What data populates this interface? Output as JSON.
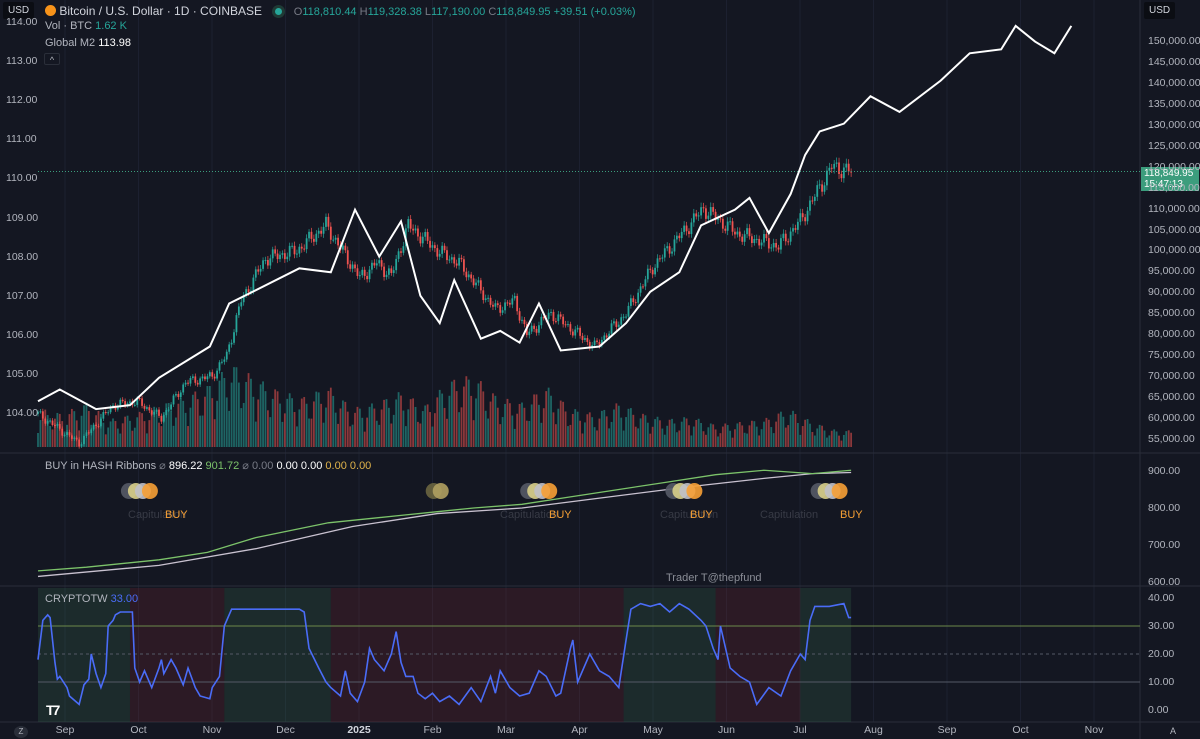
{
  "header": {
    "currency_left": "USD",
    "currency_right": "USD",
    "symbol": "Bitcoin / U.S. Dollar · 1D · COINBASE",
    "o_label": "O",
    "o": "118,810.44",
    "h_label": "H",
    "h": "119,328.38",
    "l_label": "L",
    "l": "117,190.00",
    "c_label": "C",
    "c": "118,849.95",
    "change": "+39.51 (+0.03%)",
    "vol_label": "Vol · BTC",
    "vol": "1.62 K",
    "m2_label": "Global M2",
    "m2": "113.98",
    "collapse": "^"
  },
  "price_badge": {
    "price": "118,849.95",
    "countdown": "15:47:13"
  },
  "colors": {
    "up": "#26a69a",
    "down": "#ef5350",
    "m2": "#ffffff",
    "hash_fast": "#7cc36a",
    "hash_slow": "#c9c2d0",
    "osc": "#4a6cf7",
    "buy": "#f7a035"
  },
  "hash": {
    "title": "BUY in HASH Ribbons",
    "v1": "896.22",
    "v2": "901.72",
    "v3": "0.00",
    "v4": "0.00",
    "v5": "0.00",
    "v6": "0.00",
    "v7": "0.00",
    "buy_labels": [
      "BUY",
      "BUY",
      "BUY",
      "BUY"
    ],
    "cap_labels": [
      "Capitulation",
      "Capitulation",
      "Capitulation",
      "Capitulation"
    ],
    "watermark": "Trader T@thepfund"
  },
  "osc": {
    "title": "CRYPTOTW",
    "value": "33.00"
  },
  "chart_data": [
    {
      "type": "candlestick",
      "title": "Bitcoin / U.S. Dollar · 1D · COINBASE",
      "x_unit": "days since 2024-08-20",
      "ylim": [
        52000,
        157000
      ],
      "yticks": [
        "150,000.00",
        "145,000.00",
        "140,000.00",
        "135,000.00",
        "130,000.00",
        "125,000.00",
        "120,000.00",
        "115,000.00",
        "110,000.00",
        "105,000.00",
        "100,000.00",
        "95,000.00",
        "90,000.00",
        "85,000.00",
        "80,000.00",
        "75,000.00",
        "70,000.00",
        "65,000.00",
        "60,000.00",
        "55,000.00"
      ],
      "close_keypoints": [
        [
          0,
          61000
        ],
        [
          17,
          54000
        ],
        [
          31,
          63000
        ],
        [
          41,
          64000
        ],
        [
          51,
          60000
        ],
        [
          61,
          68500
        ],
        [
          72,
          70000
        ],
        [
          78,
          75000
        ],
        [
          84,
          88000
        ],
        [
          94,
          98000
        ],
        [
          107,
          100000
        ],
        [
          119,
          106000
        ],
        [
          133,
          93500
        ],
        [
          140,
          97000
        ],
        [
          146,
          94000
        ],
        [
          153,
          106000
        ],
        [
          165,
          100000
        ],
        [
          174,
          97000
        ],
        [
          189,
          86000
        ],
        [
          197,
          88000
        ],
        [
          202,
          80000
        ],
        [
          212,
          85000
        ],
        [
          230,
          77000
        ],
        [
          243,
          85000
        ],
        [
          254,
          96000
        ],
        [
          275,
          110000
        ],
        [
          289,
          104000
        ],
        [
          306,
          101000
        ],
        [
          315,
          107000
        ],
        [
          324,
          116000
        ],
        [
          328,
          120000
        ],
        [
          336,
          118850
        ]
      ],
      "volume_k_btc_every_10_days": [
        14,
        12,
        16,
        10,
        12,
        15,
        18,
        22,
        30,
        25,
        20,
        18,
        22,
        14,
        16,
        20,
        15,
        24,
        26,
        18,
        16,
        22,
        14,
        12,
        16,
        12,
        10,
        11,
        8,
        9,
        10,
        14,
        9,
        6
      ]
    },
    {
      "type": "line",
      "name": "Global M2",
      "ylim": [
        103.5,
        114.5
      ],
      "yticks": [
        "114.00",
        "113.00",
        "112.00",
        "111.00",
        "110.00",
        "109.00",
        "108.00",
        "107.00",
        "106.00",
        "105.00",
        "104.00"
      ],
      "points": [
        [
          0,
          104.3
        ],
        [
          9,
          104.6
        ],
        [
          24,
          104.1
        ],
        [
          38,
          104.2
        ],
        [
          50,
          104.9
        ],
        [
          71,
          105.7
        ],
        [
          79,
          106.8
        ],
        [
          108,
          107.7
        ],
        [
          121,
          107.6
        ],
        [
          131,
          109.2
        ],
        [
          141,
          108.0
        ],
        [
          150,
          108.9
        ],
        [
          158,
          107.0
        ],
        [
          166,
          106.3
        ],
        [
          172,
          107.4
        ],
        [
          183,
          105.9
        ],
        [
          191,
          106.1
        ],
        [
          199,
          105.8
        ],
        [
          207,
          106.8
        ],
        [
          216,
          105.6
        ],
        [
          232,
          105.7
        ],
        [
          243,
          106.3
        ],
        [
          253,
          107.1
        ],
        [
          265,
          107.6
        ],
        [
          274,
          108.8
        ],
        [
          288,
          109.2
        ],
        [
          294,
          109.5
        ],
        [
          302,
          108.6
        ],
        [
          311,
          109.6
        ],
        [
          317,
          110.6
        ],
        [
          323,
          111.2
        ],
        [
          333,
          111.4
        ],
        [
          344,
          112.1
        ],
        [
          356,
          111.7
        ],
        [
          373,
          112.5
        ],
        [
          385,
          113.2
        ],
        [
          398,
          113.3
        ],
        [
          404,
          113.9
        ],
        [
          412,
          113.5
        ],
        [
          420,
          113.2
        ],
        [
          427,
          113.9
        ]
      ]
    },
    {
      "type": "line",
      "name": "HASH Ribbons",
      "ylim": [
        580,
        930
      ],
      "yticks": [
        "900.00",
        "800.00",
        "700.00",
        "600.00"
      ],
      "series": [
        {
          "name": "fast",
          "points": [
            [
              0,
              630
            ],
            [
              20,
              640
            ],
            [
              50,
              660
            ],
            [
              70,
              680
            ],
            [
              90,
              720
            ],
            [
              120,
              760
            ],
            [
              150,
              780
            ],
            [
              165,
              790
            ],
            [
              180,
              800
            ],
            [
              200,
              810
            ],
            [
              220,
              830
            ],
            [
              240,
              850
            ],
            [
              260,
              870
            ],
            [
              280,
              890
            ],
            [
              300,
              902
            ],
            [
              320,
              893
            ],
            [
              336,
              902
            ]
          ]
        },
        {
          "name": "slow",
          "points": [
            [
              0,
              615
            ],
            [
              50,
              645
            ],
            [
              90,
              690
            ],
            [
              130,
              750
            ],
            [
              165,
              785
            ],
            [
              200,
              800
            ],
            [
              230,
              825
            ],
            [
              270,
              858
            ],
            [
              300,
              880
            ],
            [
              320,
              893
            ],
            [
              336,
              896
            ]
          ]
        }
      ],
      "signals_days": [
        45,
        166,
        210,
        270,
        330
      ]
    },
    {
      "type": "line",
      "name": "CRYPTOTW",
      "ylim": [
        -3,
        42
      ],
      "yticks": [
        "40.00",
        "30.00",
        "20.00",
        "10.00",
        "0.00"
      ],
      "levels": [
        30,
        20,
        10
      ],
      "zones": [
        [
          0,
          38,
          "green"
        ],
        [
          38,
          77,
          "red"
        ],
        [
          77,
          121,
          "green"
        ],
        [
          121,
          242,
          "red"
        ],
        [
          242,
          280,
          "green"
        ],
        [
          280,
          315,
          "red"
        ],
        [
          315,
          336,
          "green"
        ]
      ],
      "points": [
        [
          0,
          18
        ],
        [
          2,
          32
        ],
        [
          4,
          34
        ],
        [
          5,
          33
        ],
        [
          7,
          17
        ],
        [
          8,
          11
        ],
        [
          9,
          12
        ],
        [
          12,
          8
        ],
        [
          13,
          5
        ],
        [
          17,
          2
        ],
        [
          19,
          9
        ],
        [
          21,
          11
        ],
        [
          22,
          20
        ],
        [
          24,
          13
        ],
        [
          26,
          8
        ],
        [
          28,
          13
        ],
        [
          29,
          30
        ],
        [
          31,
          32
        ],
        [
          32,
          34
        ],
        [
          34,
          35
        ],
        [
          39,
          35
        ],
        [
          40,
          15
        ],
        [
          42,
          10
        ],
        [
          44,
          14
        ],
        [
          47,
          8
        ],
        [
          50,
          15
        ],
        [
          51,
          18
        ],
        [
          52,
          13
        ],
        [
          55,
          18
        ],
        [
          57,
          15
        ],
        [
          60,
          9
        ],
        [
          62,
          15
        ],
        [
          65,
          8
        ],
        [
          67,
          5
        ],
        [
          71,
          4
        ],
        [
          72,
          8
        ],
        [
          75,
          12
        ],
        [
          77,
          30
        ],
        [
          80,
          36
        ],
        [
          108,
          36
        ],
        [
          110,
          35
        ],
        [
          112,
          22
        ],
        [
          116,
          15
        ],
        [
          119,
          10
        ],
        [
          121,
          8
        ],
        [
          125,
          5
        ],
        [
          127,
          14
        ],
        [
          129,
          6
        ],
        [
          132,
          3
        ],
        [
          135,
          10
        ],
        [
          137,
          22
        ],
        [
          139,
          18
        ],
        [
          143,
          14
        ],
        [
          146,
          20
        ],
        [
          148,
          28
        ],
        [
          150,
          17
        ],
        [
          152,
          12
        ],
        [
          155,
          12
        ],
        [
          157,
          6
        ],
        [
          160,
          4
        ],
        [
          163,
          6
        ],
        [
          166,
          3
        ],
        [
          170,
          5
        ],
        [
          174,
          2
        ],
        [
          179,
          8
        ],
        [
          183,
          3
        ],
        [
          187,
          12
        ],
        [
          189,
          6
        ],
        [
          191,
          14
        ],
        [
          195,
          8
        ],
        [
          199,
          5
        ],
        [
          203,
          6
        ],
        [
          207,
          14
        ],
        [
          210,
          12
        ],
        [
          214,
          5
        ],
        [
          216,
          6
        ],
        [
          218,
          14
        ],
        [
          220,
          22
        ],
        [
          221,
          25
        ],
        [
          223,
          10
        ],
        [
          228,
          20
        ],
        [
          232,
          14
        ],
        [
          236,
          12
        ],
        [
          240,
          8
        ],
        [
          243,
          25
        ],
        [
          245,
          36
        ],
        [
          249,
          38
        ],
        [
          253,
          37
        ],
        [
          257,
          38
        ],
        [
          261,
          35
        ],
        [
          265,
          38
        ],
        [
          269,
          36
        ],
        [
          274,
          32
        ],
        [
          276,
          30
        ],
        [
          279,
          22
        ],
        [
          281,
          18
        ],
        [
          282,
          30
        ],
        [
          286,
          15
        ],
        [
          290,
          12
        ],
        [
          294,
          10
        ],
        [
          297,
          2
        ],
        [
          302,
          8
        ],
        [
          307,
          5
        ],
        [
          311,
          14
        ],
        [
          315,
          20
        ],
        [
          317,
          18
        ],
        [
          319,
          32
        ],
        [
          321,
          37
        ],
        [
          327,
          37
        ],
        [
          333,
          38
        ],
        [
          335,
          33
        ],
        [
          336,
          33
        ]
      ]
    },
    {
      "type": "axis",
      "xticks": [
        "Sep",
        "Oct",
        "Nov",
        "Dec",
        "2025",
        "Feb",
        "Mar",
        "Apr",
        "May",
        "Jun",
        "Jul",
        "Aug",
        "Sep",
        "Oct",
        "Nov"
      ]
    }
  ]
}
